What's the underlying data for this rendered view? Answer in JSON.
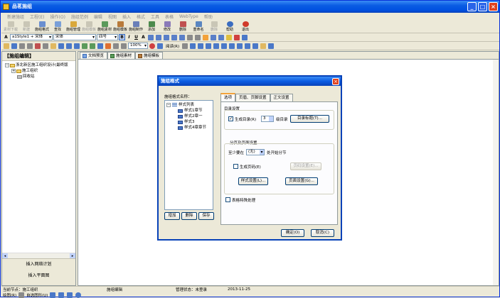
{
  "window": {
    "title": "品茗施组"
  },
  "menu": [
    "新建施组",
    "工程(E)",
    "操作(O)",
    "施组范例",
    "编辑",
    "视图",
    "插入",
    "格式",
    "工具",
    "表格",
    "WebType",
    "帮助"
  ],
  "toolbar": [
    {
      "label": "素材下载",
      "enabled": false
    },
    {
      "label": "新建",
      "enabled": false
    },
    {
      "label": "施组格式",
      "enabled": true
    },
    {
      "label": "查找",
      "enabled": true
    },
    {
      "label": "施组管理",
      "enabled": true
    },
    {
      "label": "施组模板",
      "enabled": false
    },
    {
      "label": "施组素材",
      "enabled": true
    },
    {
      "label": "施组模板",
      "enabled": true
    },
    {
      "label": "施组制作",
      "enabled": true
    },
    {
      "label": "添加",
      "enabled": true
    },
    {
      "label": "修改",
      "enabled": true
    },
    {
      "label": "删除",
      "enabled": true
    },
    {
      "label": "重命名",
      "enabled": true
    },
    {
      "label": "删除",
      "enabled": false
    },
    {
      "label": "帮助",
      "enabled": true
    },
    {
      "label": "退出",
      "enabled": true
    }
  ],
  "format": {
    "style": "a1Style1 + 宋体",
    "font": "宋体",
    "size": "四号",
    "bold": "B",
    "italic": "I",
    "underline": "U",
    "font_color_a": "A"
  },
  "toolbar3": {
    "zoom": "100%",
    "read_mode": "阅读(R)"
  },
  "left_panel": {
    "title": "【施组编辑】",
    "tree_root": "浙北新区施工组织设计(最终版",
    "tree_child_1": "施工组织",
    "tree_child_2": "回收站",
    "insert_network": "插入网络计划",
    "insert_plan": "插入平面图"
  },
  "main_tabs": [
    "文档预览",
    "施组素材",
    "施组模板"
  ],
  "dialog": {
    "title": "施组格式",
    "list_label": "施组格式名称：",
    "list_items": [
      "样式列表",
      "样式1章节",
      "样式2章一",
      "样式3",
      "样式4章章节"
    ],
    "add": "增加",
    "delete": "删除",
    "save": "保存",
    "tabs": [
      "选项",
      "页眉、页脚设置",
      "正文设置"
    ],
    "toc_group": "目录设置",
    "gen_toc": "生成目录(R)",
    "toc_level": "3",
    "toc_level_suffix": "级目录",
    "toc_title_btn": "目录标题(T)...",
    "page_group": "分页及页面设置",
    "at_least": "至少要在",
    "at_least_value": "(无)",
    "after_split": "处开始分节",
    "page_num": "生成页码(E)",
    "page_num_btn": "页码设置(E)...",
    "style_btn": "样式设置(L)...",
    "page_setup_btn": "页面设置(G)...",
    "table_special": "表格特殊处理",
    "ok": "确定(O)",
    "cancel": "取消(C)"
  },
  "status": {
    "current_node": "当前节点：施工组织",
    "edit_label": "施组编辑",
    "manage_status": "管理状态：未登录",
    "date": "2013-11-25"
  },
  "draw": {
    "label": "绘图(R)",
    "autoshape": "自选图形(U)"
  },
  "colors": {
    "titlebar": "#0a5ce3",
    "face": "#ece9d8",
    "accent": "#f3a23a"
  }
}
